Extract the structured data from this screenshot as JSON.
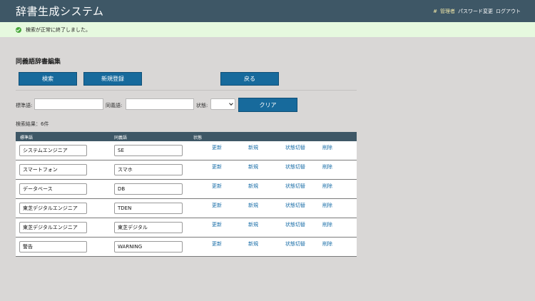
{
  "header": {
    "title": "辞書生成システム",
    "user_prefix": "#",
    "user_name": "管理者",
    "password_change": "パスワード変更",
    "logout": "ログアウト"
  },
  "alert": {
    "message": "検索が正常に終了しました。",
    "icon": "check-circle-icon",
    "color": "#47a83a"
  },
  "section": {
    "title": "同義語辞書編集"
  },
  "toolbar": {
    "search_label": "検索",
    "new_label": "新規登録",
    "back_label": "戻る"
  },
  "filters": {
    "standard_label": "標準語:",
    "standard_value": "",
    "synonym_label": "同義語:",
    "synonym_value": "",
    "status_label": "状態:",
    "status_value": "",
    "clear_label": "クリア"
  },
  "results": {
    "count_text": "検索結果：6件"
  },
  "table": {
    "headers": [
      "標準語",
      "同義語",
      "状態"
    ],
    "actions": [
      "更新",
      "新規",
      "状態切替",
      "削除"
    ],
    "rows": [
      {
        "standard": "システムエンジニア",
        "synonym": "SE"
      },
      {
        "standard": "スマートフォン",
        "synonym": "スマホ"
      },
      {
        "standard": "データベース",
        "synonym": "DB"
      },
      {
        "standard": "東芝デジタルエンジニア",
        "synonym": "TDEN"
      },
      {
        "standard": "東芝デジタルエンジニア",
        "synonym": "東芝デジタル"
      },
      {
        "standard": "警告",
        "synonym": "WARNING"
      }
    ]
  },
  "colors": {
    "header_bg": "#3e5766",
    "button_bg": "#176a9c",
    "link": "#1a6ea8",
    "alert_bg": "#e6f9df"
  }
}
